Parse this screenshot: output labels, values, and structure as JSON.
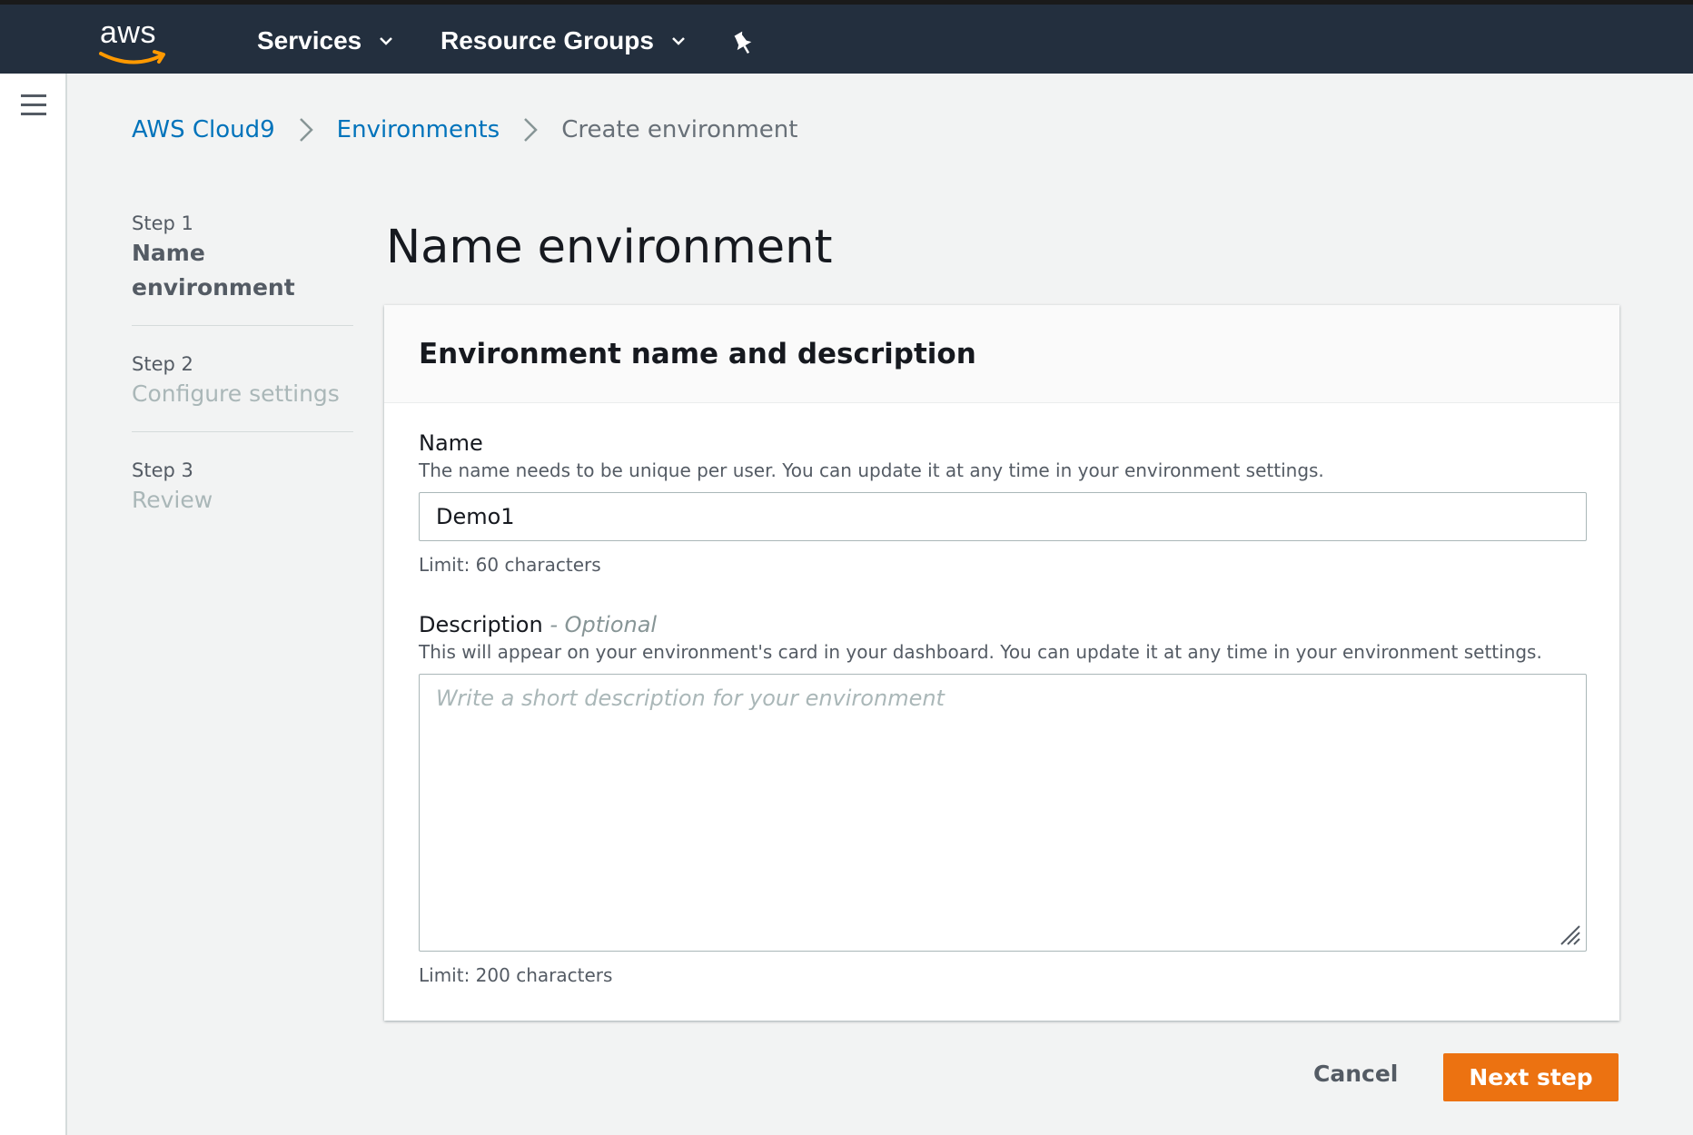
{
  "topnav": {
    "logo_text": "aws",
    "services_label": "Services",
    "resource_groups_label": "Resource Groups",
    "pin_icon": "pushpin-icon",
    "background": "#232f3e"
  },
  "siderail": {
    "menu_icon": "hamburger-menu-icon"
  },
  "breadcrumb": {
    "items": [
      "AWS Cloud9",
      "Environments"
    ],
    "current": "Create environment"
  },
  "steps": [
    {
      "number": "Step 1",
      "title": "Name environment"
    },
    {
      "number": "Step 2",
      "title": "Configure settings"
    },
    {
      "number": "Step 3",
      "title": "Review"
    }
  ],
  "page_title": "Name environment",
  "card": {
    "header": "Environment name and description",
    "name_field": {
      "label": "Name",
      "help": "The name needs to be unique per user. You can update it at any time in your environment settings.",
      "value": "Demo1",
      "limit": "Limit: 60 characters"
    },
    "description_field": {
      "label": "Description",
      "optional": "- Optional",
      "help": "This will appear on your environment's card in your dashboard. You can update it at any time in your environment settings.",
      "placeholder": "Write a short description for your environment",
      "limit": "Limit: 200 characters"
    }
  },
  "actions": {
    "cancel_label": "Cancel",
    "next_label": "Next step",
    "primary_color": "#ec7211"
  }
}
